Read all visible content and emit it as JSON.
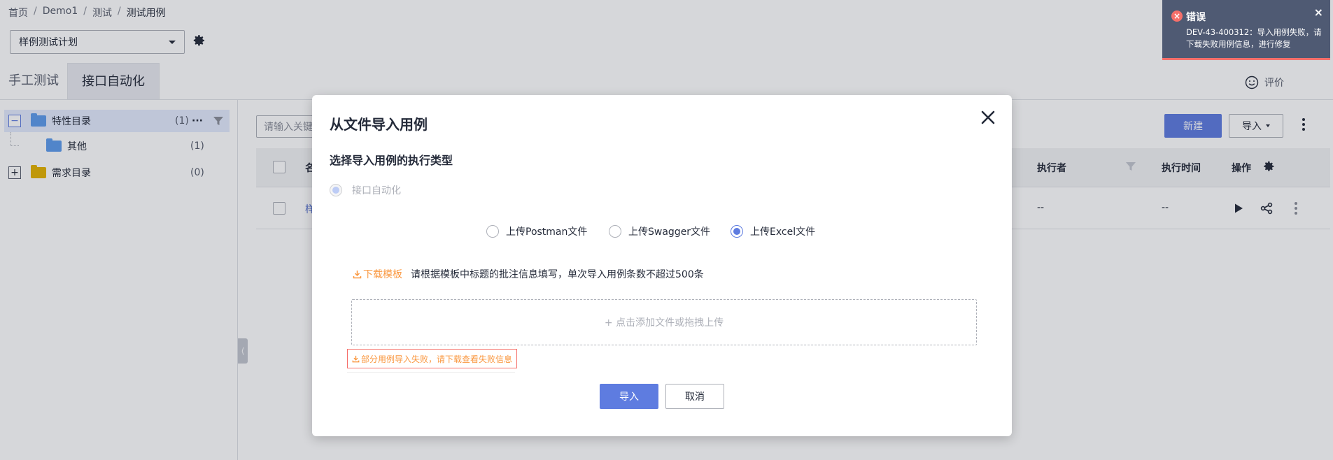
{
  "breadcrumb": [
    "首页",
    "Demo1",
    "测试",
    "测试用例"
  ],
  "plan_select": {
    "value": "样例测试计划"
  },
  "tabs": [
    {
      "label": "手工测试",
      "active": false
    },
    {
      "label": "接口自动化",
      "active": true
    }
  ],
  "rate_label": "评价",
  "tree": {
    "items": [
      {
        "label": "特性目录",
        "count": "(1)",
        "folder_color": "#5d9cec",
        "selected": true
      },
      {
        "label": "其他",
        "count": "(1)",
        "folder_color": "#5d9cec",
        "selected": false
      },
      {
        "label": "需求目录",
        "count": "(0)",
        "folder_color": "#e5b300",
        "selected": false
      }
    ],
    "more_label": "···"
  },
  "main": {
    "search_placeholder": "请输入关键",
    "new_button": "新建",
    "import_button": "导入",
    "table": {
      "headers": {
        "name": "名",
        "executor": "执行者",
        "exec_time": "执行时间",
        "actions": "操作"
      },
      "row": {
        "name": "样",
        "executor": "--",
        "exec_time": "--"
      }
    }
  },
  "modal": {
    "title": "从文件导入用例",
    "section_title": "选择导入用例的执行类型",
    "exec_type": {
      "label": "接口自动化",
      "checked": true,
      "disabled": true
    },
    "upload_options": [
      {
        "label": "上传Postman文件",
        "checked": false
      },
      {
        "label": "上传Swagger文件",
        "checked": false
      },
      {
        "label": "上传Excel文件",
        "checked": true
      }
    ],
    "download_template": "下载模板",
    "template_hint": "请根据模板中标题的批注信息填写，单次导入用例条数不超过500条",
    "dropzone_text": "+ 点击添加文件或拖拽上传",
    "fail_link": "部分用例导入失败，请下载查看失败信息",
    "import_button": "导入",
    "cancel_button": "取消"
  },
  "toast": {
    "title": "错误",
    "message": "DEV-43-400312：导入用例失败，请下载失败用例信息，进行修复"
  },
  "colors": {
    "primary": "#5e7ce0",
    "warning": "#fa9841",
    "danger": "#f66f6a",
    "toast_bg": "#4f5a73"
  }
}
